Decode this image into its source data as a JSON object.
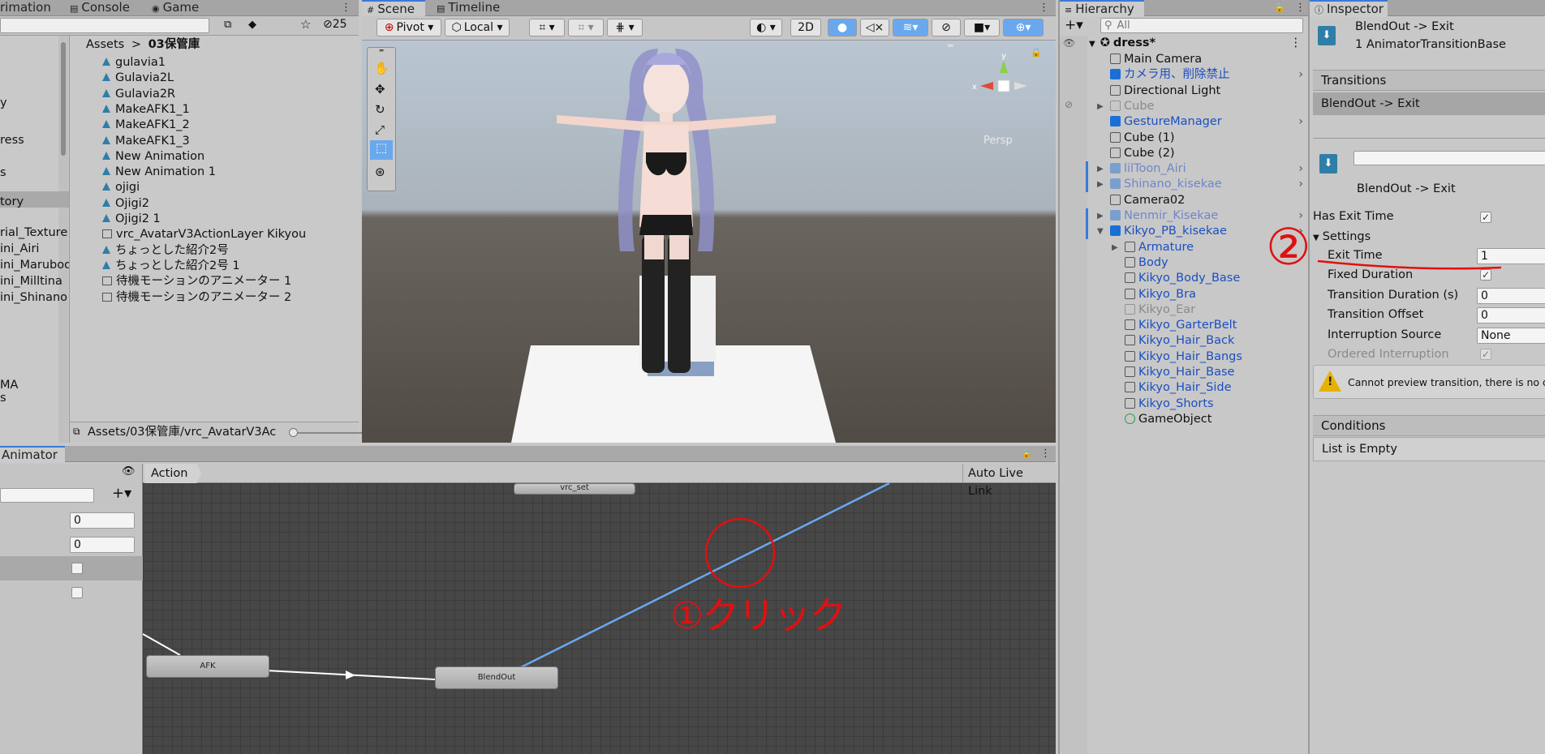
{
  "left_tabs": {
    "animation": "rimation",
    "console": "Console",
    "game": "Game",
    "count": "25"
  },
  "project": {
    "breadcrumb_root": "Assets",
    "breadcrumb_sep": ">",
    "breadcrumb_folder": "03保管庫",
    "left_tree": [
      "y",
      "ress",
      "s",
      "tory",
      "rial_Texture",
      "ini_Airi",
      "ini_Marubod",
      "ini_Milltina",
      "ini_Shinano",
      "MA",
      "s"
    ],
    "items": [
      {
        "type": "anim",
        "label": "gulavia1"
      },
      {
        "type": "anim",
        "label": "Gulavia2L"
      },
      {
        "type": "anim",
        "label": "Gulavia2R"
      },
      {
        "type": "anim",
        "label": "MakeAFK1_1"
      },
      {
        "type": "anim",
        "label": "MakeAFK1_2"
      },
      {
        "type": "anim",
        "label": "MakeAFK1_3"
      },
      {
        "type": "anim",
        "label": "New Animation"
      },
      {
        "type": "anim",
        "label": "New Animation 1"
      },
      {
        "type": "anim",
        "label": "ojigi"
      },
      {
        "type": "anim",
        "label": "Ojigi2"
      },
      {
        "type": "anim",
        "label": "Ojigi2 1"
      },
      {
        "type": "ctrl",
        "label": "vrc_AvatarV3ActionLayer Kikyou"
      },
      {
        "type": "anim",
        "label": "ちょっとした紹介2号"
      },
      {
        "type": "anim",
        "label": "ちょっとした紹介2号 1"
      },
      {
        "type": "ctrl",
        "label": "待機モーションのアニメーター 1"
      },
      {
        "type": "ctrl",
        "label": "待機モーションのアニメーター 2"
      }
    ],
    "footer_path": "Assets/03保管庫/vrc_AvatarV3Ac"
  },
  "scene": {
    "tab_scene": "Scene",
    "tab_timeline": "Timeline",
    "pivot": "Pivot",
    "local": "Local",
    "mode_2d": "2D",
    "persp": "Persp",
    "gizmo_y": "y",
    "gizmo_x": "x"
  },
  "hierarchy": {
    "title": "Hierarchy",
    "search_placeholder": "All",
    "root": "dress*",
    "items": [
      {
        "label": "Main Camera",
        "style": "normal",
        "indent": 1,
        "icon": "cube"
      },
      {
        "label": "カメラ用、削除禁止",
        "style": "prefab",
        "indent": 1,
        "icon": "cube-blue",
        "chevron": true
      },
      {
        "label": "Directional Light",
        "style": "normal",
        "indent": 1,
        "icon": "cube"
      },
      {
        "label": "Cube",
        "style": "grey",
        "indent": 1,
        "icon": "cube",
        "arrow": true
      },
      {
        "label": "GestureManager",
        "style": "prefab",
        "indent": 1,
        "icon": "cube-blue",
        "chevron": true
      },
      {
        "label": "Cube (1)",
        "style": "normal",
        "indent": 1,
        "icon": "cube"
      },
      {
        "label": "Cube (2)",
        "style": "normal",
        "indent": 1,
        "icon": "cube"
      },
      {
        "label": "lilToon_Airi",
        "style": "prefab-grey",
        "indent": 1,
        "icon": "cube-blue",
        "arrow": true,
        "chevron": true
      },
      {
        "label": "Shinano_kisekae",
        "style": "prefab-grey",
        "indent": 1,
        "icon": "cube-blue",
        "arrow": true,
        "chevron": true
      },
      {
        "label": "Camera02",
        "style": "normal",
        "indent": 1,
        "icon": "cube"
      },
      {
        "label": "Nenmir_Kisekae",
        "style": "prefab-grey",
        "indent": 1,
        "icon": "cube-blue",
        "arrow": true,
        "chevron": true
      },
      {
        "label": "Kikyo_PB_kisekae",
        "style": "prefab",
        "indent": 1,
        "icon": "cube-blue",
        "arrow_open": true,
        "chevron": true
      },
      {
        "label": "Armature",
        "style": "prefab",
        "indent": 2,
        "icon": "cube",
        "arrow": true
      },
      {
        "label": "Body",
        "style": "prefab",
        "indent": 2,
        "icon": "cube"
      },
      {
        "label": "Kikyo_Body_Base",
        "style": "prefab",
        "indent": 2,
        "icon": "cube"
      },
      {
        "label": "Kikyo_Bra",
        "style": "prefab",
        "indent": 2,
        "icon": "cube"
      },
      {
        "label": "Kikyo_Ear",
        "style": "grey",
        "indent": 2,
        "icon": "cube"
      },
      {
        "label": "Kikyo_GarterBelt",
        "style": "prefab",
        "indent": 2,
        "icon": "cube"
      },
      {
        "label": "Kikyo_Hair_Back",
        "style": "prefab",
        "indent": 2,
        "icon": "cube"
      },
      {
        "label": "Kikyo_Hair_Bangs",
        "style": "prefab",
        "indent": 2,
        "icon": "cube"
      },
      {
        "label": "Kikyo_Hair_Base",
        "style": "prefab",
        "indent": 2,
        "icon": "cube"
      },
      {
        "label": "Kikyo_Hair_Side",
        "style": "prefab",
        "indent": 2,
        "icon": "cube"
      },
      {
        "label": "Kikyo_Shorts",
        "style": "prefab",
        "indent": 2,
        "icon": "cube"
      },
      {
        "label": "GameObject",
        "style": "normal",
        "indent": 2,
        "icon": "cube-green"
      }
    ]
  },
  "inspector": {
    "title": "Inspector",
    "header_title": "BlendOut -> Exit",
    "header_sub": "1 AnimatorTransitionBase",
    "transitions_header": "Transitions",
    "transition_item": "BlendOut -> Exit",
    "sub_title": "BlendOut -> Exit",
    "has_exit_time_label": "Has Exit Time",
    "settings_label": "Settings",
    "fields": [
      {
        "label": "Exit Time",
        "value": "1",
        "kind": "text"
      },
      {
        "label": "Fixed Duration",
        "value": "✓",
        "kind": "check"
      },
      {
        "label": "Transition Duration (s)",
        "value": "0",
        "kind": "text"
      },
      {
        "label": "Transition Offset",
        "value": "0",
        "kind": "text"
      },
      {
        "label": "Interruption Source",
        "value": "None",
        "kind": "text"
      },
      {
        "label": "Ordered Interruption",
        "value": "✓",
        "kind": "check",
        "disabled": true
      }
    ],
    "warning": "Cannot preview transition, there is no des",
    "conditions_header": "Conditions",
    "conditions_empty": "List is Empty"
  },
  "animator": {
    "tab": "Animator",
    "breadcrumb": "Action",
    "auto_live_link": "Auto Live Link",
    "params": [
      "0",
      "0"
    ],
    "states": {
      "afk": "AFK",
      "blendout": "BlendOut",
      "top": "vrc_set"
    },
    "annotation_1": "①クリック",
    "annotation_2": "②"
  },
  "colors": {
    "accent_blue": "#3c79d8",
    "transition_line": "#6aa8ee",
    "annotation_red": "#e01010",
    "prefab_text": "#1a4fc2",
    "graph_bg": "#474747"
  }
}
